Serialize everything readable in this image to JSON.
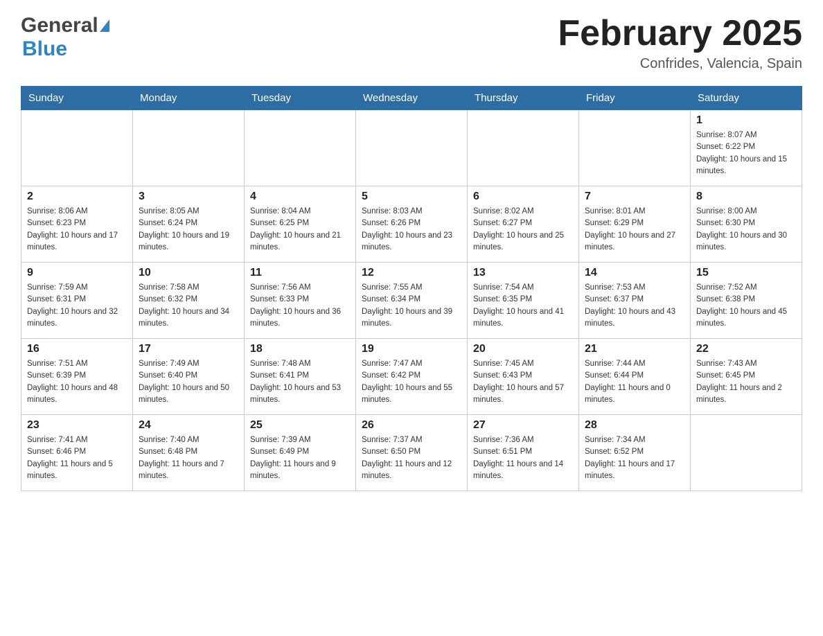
{
  "header": {
    "title": "February 2025",
    "subtitle": "Confrides, Valencia, Spain",
    "logo_general": "General",
    "logo_blue": "Blue"
  },
  "days_of_week": [
    "Sunday",
    "Monday",
    "Tuesday",
    "Wednesday",
    "Thursday",
    "Friday",
    "Saturday"
  ],
  "weeks": [
    {
      "days": [
        {
          "date": "",
          "info": ""
        },
        {
          "date": "",
          "info": ""
        },
        {
          "date": "",
          "info": ""
        },
        {
          "date": "",
          "info": ""
        },
        {
          "date": "",
          "info": ""
        },
        {
          "date": "",
          "info": ""
        },
        {
          "date": "1",
          "info": "Sunrise: 8:07 AM\nSunset: 6:22 PM\nDaylight: 10 hours and 15 minutes."
        }
      ]
    },
    {
      "days": [
        {
          "date": "2",
          "info": "Sunrise: 8:06 AM\nSunset: 6:23 PM\nDaylight: 10 hours and 17 minutes."
        },
        {
          "date": "3",
          "info": "Sunrise: 8:05 AM\nSunset: 6:24 PM\nDaylight: 10 hours and 19 minutes."
        },
        {
          "date": "4",
          "info": "Sunrise: 8:04 AM\nSunset: 6:25 PM\nDaylight: 10 hours and 21 minutes."
        },
        {
          "date": "5",
          "info": "Sunrise: 8:03 AM\nSunset: 6:26 PM\nDaylight: 10 hours and 23 minutes."
        },
        {
          "date": "6",
          "info": "Sunrise: 8:02 AM\nSunset: 6:27 PM\nDaylight: 10 hours and 25 minutes."
        },
        {
          "date": "7",
          "info": "Sunrise: 8:01 AM\nSunset: 6:29 PM\nDaylight: 10 hours and 27 minutes."
        },
        {
          "date": "8",
          "info": "Sunrise: 8:00 AM\nSunset: 6:30 PM\nDaylight: 10 hours and 30 minutes."
        }
      ]
    },
    {
      "days": [
        {
          "date": "9",
          "info": "Sunrise: 7:59 AM\nSunset: 6:31 PM\nDaylight: 10 hours and 32 minutes."
        },
        {
          "date": "10",
          "info": "Sunrise: 7:58 AM\nSunset: 6:32 PM\nDaylight: 10 hours and 34 minutes."
        },
        {
          "date": "11",
          "info": "Sunrise: 7:56 AM\nSunset: 6:33 PM\nDaylight: 10 hours and 36 minutes."
        },
        {
          "date": "12",
          "info": "Sunrise: 7:55 AM\nSunset: 6:34 PM\nDaylight: 10 hours and 39 minutes."
        },
        {
          "date": "13",
          "info": "Sunrise: 7:54 AM\nSunset: 6:35 PM\nDaylight: 10 hours and 41 minutes."
        },
        {
          "date": "14",
          "info": "Sunrise: 7:53 AM\nSunset: 6:37 PM\nDaylight: 10 hours and 43 minutes."
        },
        {
          "date": "15",
          "info": "Sunrise: 7:52 AM\nSunset: 6:38 PM\nDaylight: 10 hours and 45 minutes."
        }
      ]
    },
    {
      "days": [
        {
          "date": "16",
          "info": "Sunrise: 7:51 AM\nSunset: 6:39 PM\nDaylight: 10 hours and 48 minutes."
        },
        {
          "date": "17",
          "info": "Sunrise: 7:49 AM\nSunset: 6:40 PM\nDaylight: 10 hours and 50 minutes."
        },
        {
          "date": "18",
          "info": "Sunrise: 7:48 AM\nSunset: 6:41 PM\nDaylight: 10 hours and 53 minutes."
        },
        {
          "date": "19",
          "info": "Sunrise: 7:47 AM\nSunset: 6:42 PM\nDaylight: 10 hours and 55 minutes."
        },
        {
          "date": "20",
          "info": "Sunrise: 7:45 AM\nSunset: 6:43 PM\nDaylight: 10 hours and 57 minutes."
        },
        {
          "date": "21",
          "info": "Sunrise: 7:44 AM\nSunset: 6:44 PM\nDaylight: 11 hours and 0 minutes."
        },
        {
          "date": "22",
          "info": "Sunrise: 7:43 AM\nSunset: 6:45 PM\nDaylight: 11 hours and 2 minutes."
        }
      ]
    },
    {
      "days": [
        {
          "date": "23",
          "info": "Sunrise: 7:41 AM\nSunset: 6:46 PM\nDaylight: 11 hours and 5 minutes."
        },
        {
          "date": "24",
          "info": "Sunrise: 7:40 AM\nSunset: 6:48 PM\nDaylight: 11 hours and 7 minutes."
        },
        {
          "date": "25",
          "info": "Sunrise: 7:39 AM\nSunset: 6:49 PM\nDaylight: 11 hours and 9 minutes."
        },
        {
          "date": "26",
          "info": "Sunrise: 7:37 AM\nSunset: 6:50 PM\nDaylight: 11 hours and 12 minutes."
        },
        {
          "date": "27",
          "info": "Sunrise: 7:36 AM\nSunset: 6:51 PM\nDaylight: 11 hours and 14 minutes."
        },
        {
          "date": "28",
          "info": "Sunrise: 7:34 AM\nSunset: 6:52 PM\nDaylight: 11 hours and 17 minutes."
        },
        {
          "date": "",
          "info": ""
        }
      ]
    }
  ]
}
